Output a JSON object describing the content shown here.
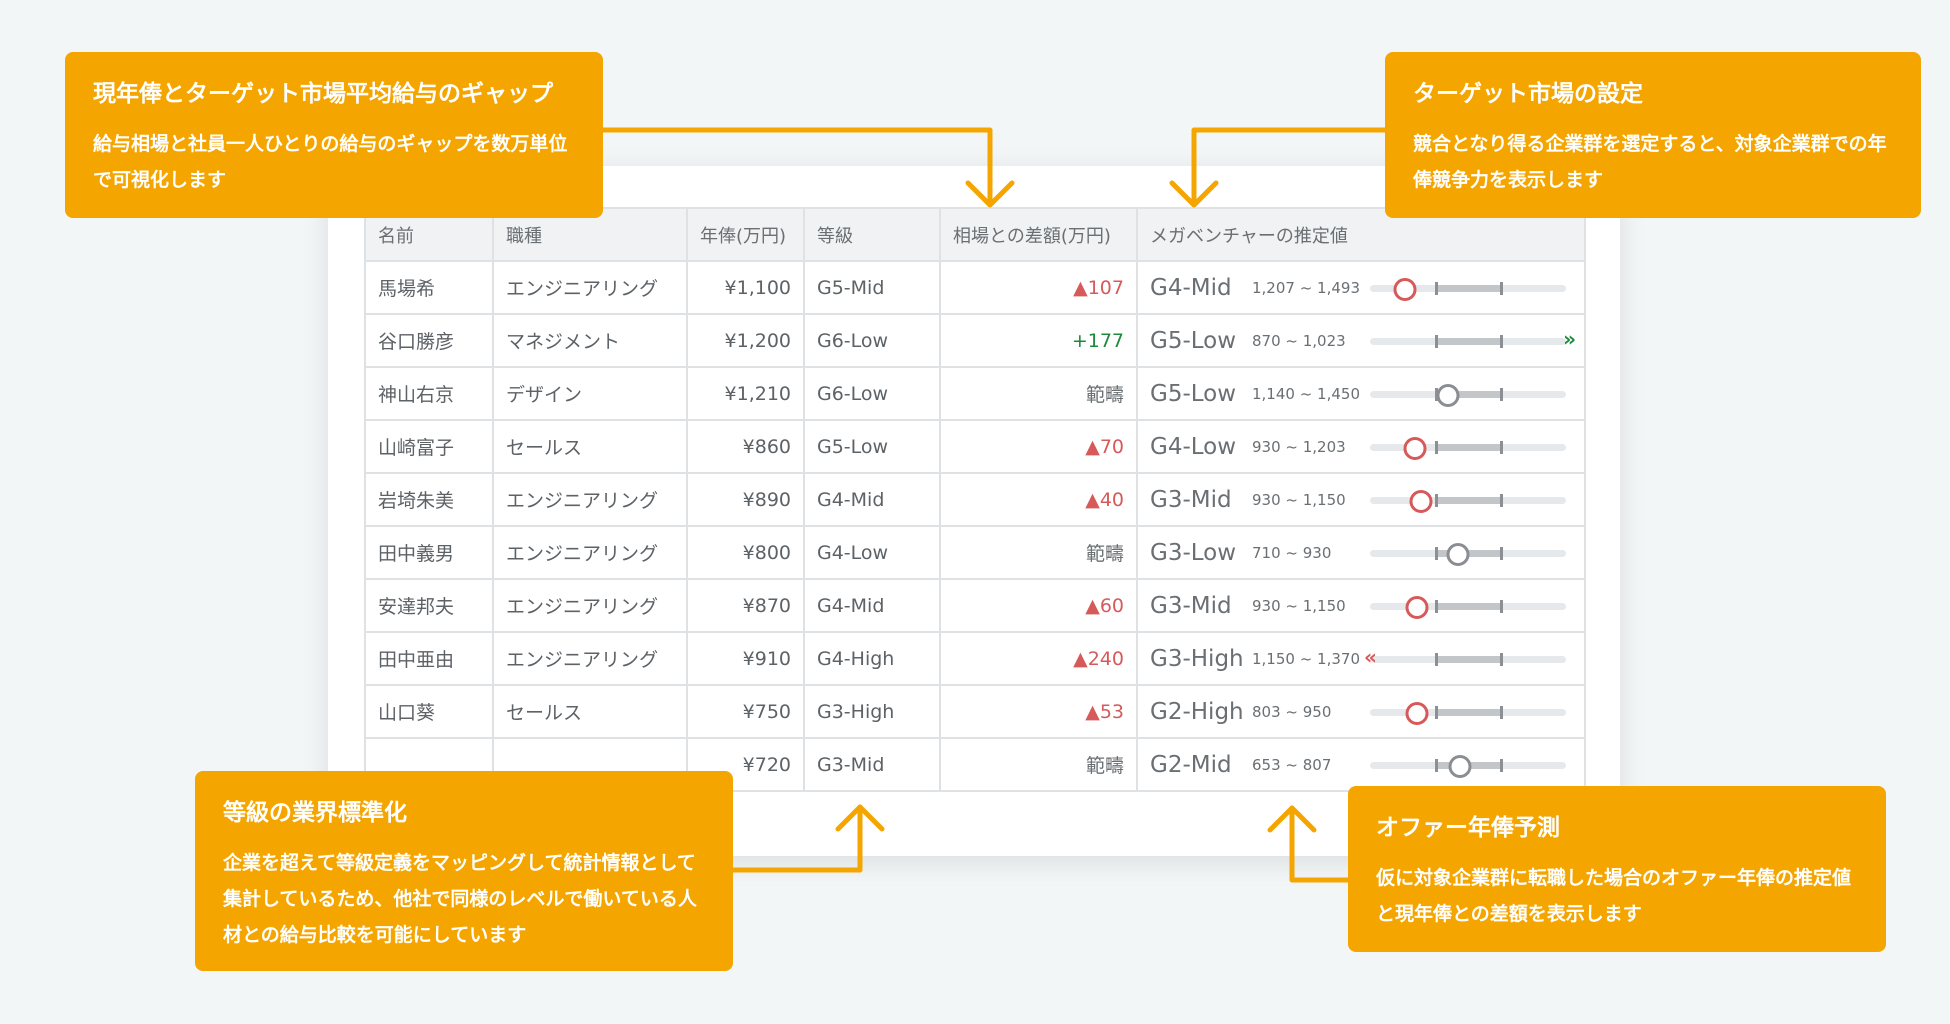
{
  "table": {
    "headers": [
      "名前",
      "職種",
      "年俸(万円)",
      "等級",
      "相場との差額(万円)",
      "メガベンチャーの推定値"
    ],
    "rows": [
      {
        "name": "馬場希",
        "job": "エンジニアリング",
        "salary": "¥1,100",
        "grade": "G5-Mid",
        "diff": "▲107",
        "diff_kind": "neg",
        "est_grade": "G4-Mid",
        "est_range": "1,207 ~ 1,493",
        "marker": 0.18,
        "marker_kind": "below",
        "overflow": "none"
      },
      {
        "name": "谷口勝彦",
        "job": "マネジメント",
        "salary": "¥1,200",
        "grade": "G6-Low",
        "diff": "+177",
        "diff_kind": "pos",
        "est_grade": "G5-Low",
        "est_range": "870 ~ 1,023",
        "marker": 1.0,
        "marker_kind": "above",
        "overflow": "right"
      },
      {
        "name": "神山右京",
        "job": "デザイン",
        "salary": "¥1,210",
        "grade": "G6-Low",
        "diff": "範疇",
        "diff_kind": "neu",
        "est_grade": "G5-Low",
        "est_range": "1,140 ~ 1,450",
        "marker": 0.4,
        "marker_kind": "within",
        "overflow": "none"
      },
      {
        "name": "山崎富子",
        "job": "セールス",
        "salary": "¥860",
        "grade": "G5-Low",
        "diff": "▲70",
        "diff_kind": "neg",
        "est_grade": "G4-Low",
        "est_range": "930 ~ 1,203",
        "marker": 0.23,
        "marker_kind": "below",
        "overflow": "none"
      },
      {
        "name": "岩埼朱美",
        "job": "エンジニアリング",
        "salary": "¥890",
        "grade": "G4-Mid",
        "diff": "▲40",
        "diff_kind": "neg",
        "est_grade": "G3-Mid",
        "est_range": "930 ~ 1,150",
        "marker": 0.26,
        "marker_kind": "below",
        "overflow": "none"
      },
      {
        "name": "田中義男",
        "job": "エンジニアリング",
        "salary": "¥800",
        "grade": "G4-Low",
        "diff": "範疇",
        "diff_kind": "neu",
        "est_grade": "G3-Low",
        "est_range": "710 ~ 930",
        "marker": 0.45,
        "marker_kind": "within",
        "overflow": "none"
      },
      {
        "name": "安達邦夫",
        "job": "エンジニアリング",
        "salary": "¥870",
        "grade": "G4-Mid",
        "diff": "▲60",
        "diff_kind": "neg",
        "est_grade": "G3-Mid",
        "est_range": "930 ~ 1,150",
        "marker": 0.24,
        "marker_kind": "below",
        "overflow": "none"
      },
      {
        "name": "田中亜由",
        "job": "エンジニアリング",
        "salary": "¥910",
        "grade": "G4-High",
        "diff": "▲240",
        "diff_kind": "neg",
        "est_grade": "G3-High",
        "est_range": "1,150 ~ 1,370",
        "marker": 0.0,
        "marker_kind": "below",
        "overflow": "left"
      },
      {
        "name": "山口葵",
        "job": "セールス",
        "salary": "¥750",
        "grade": "G3-High",
        "diff": "▲53",
        "diff_kind": "neg",
        "est_grade": "G2-High",
        "est_range": "803 ~ 950",
        "marker": 0.24,
        "marker_kind": "below",
        "overflow": "none"
      },
      {
        "name": "",
        "job": "",
        "salary": "¥720",
        "grade": "G3-Mid",
        "diff": "範疇",
        "diff_kind": "neu",
        "est_grade": "G2-Mid",
        "est_range": "653 ~ 807",
        "marker": 0.46,
        "marker_kind": "within",
        "overflow": "none"
      }
    ]
  },
  "callouts": {
    "gap": {
      "title": "現年俸とターゲット市場平均給与のギャップ",
      "body": "給与相場と社員一人ひとりの給与のギャップを数万単位で可視化します"
    },
    "target": {
      "title": "ターゲット市場の設定",
      "body": "競合となり得る企業群を選定すると、対象企業群での年俸競争力を表示します"
    },
    "grade": {
      "title": "等級の業界標準化",
      "body": "企業を超えて等級定義をマッピングして統計情報として集計しているため、他社で同様のレベルで働いている人材との給与比較を可能にしています"
    },
    "offer": {
      "title": "オファー年俸予測",
      "body": "仮に対象企業群に転職した場合のオファー年俸の推定値と現年俸との差額を表示します"
    }
  },
  "colors": {
    "accent": "#f5a500",
    "negative": "#d65a5a",
    "positive": "#1c8a3d"
  }
}
